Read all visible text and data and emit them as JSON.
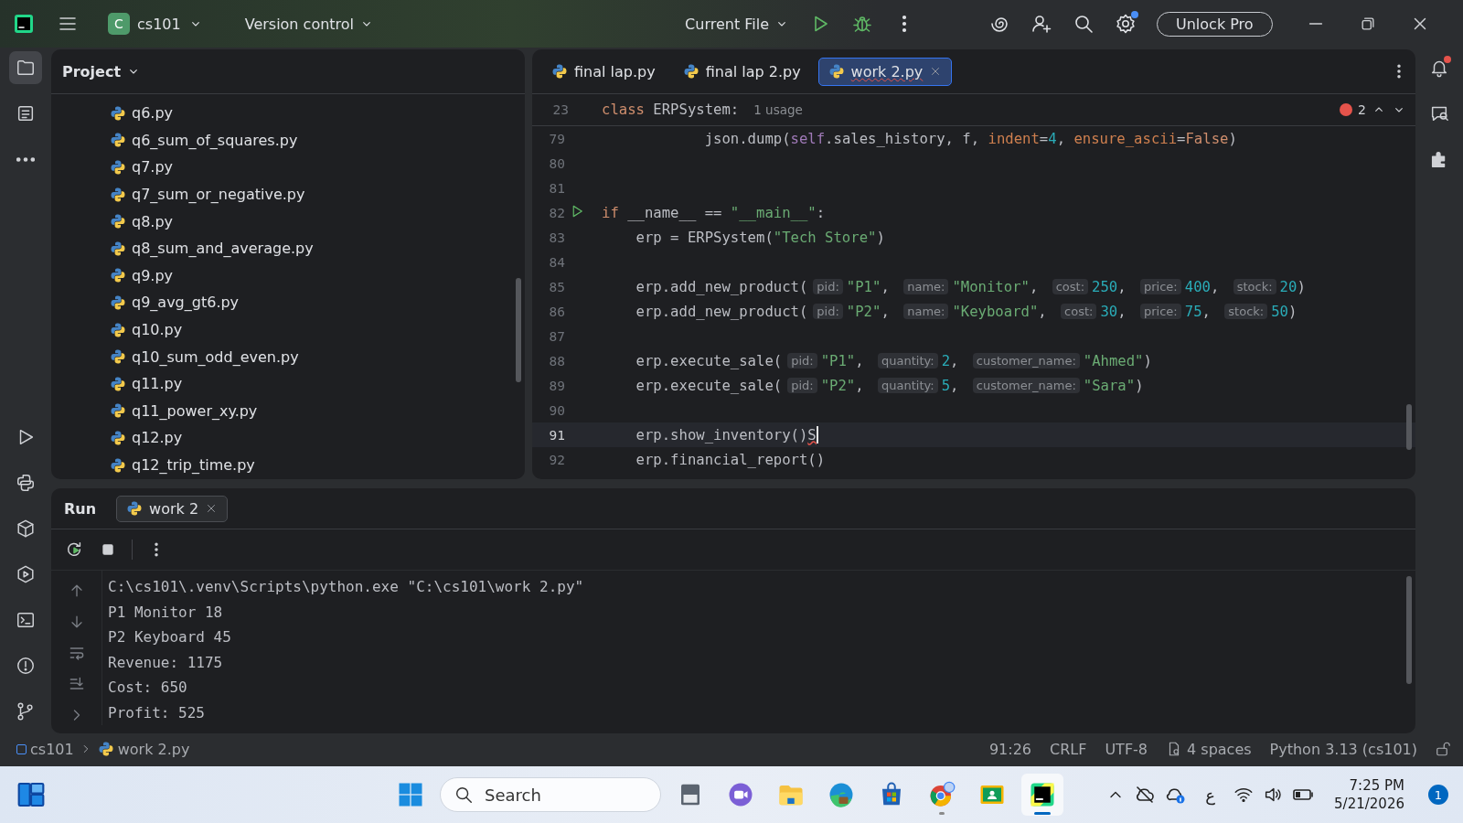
{
  "title_bar": {
    "project_badge": "C",
    "project": "cs101",
    "vcs": "Version control",
    "run_config": "Current File",
    "settings_update": true,
    "unlock_button": "Unlock Pro"
  },
  "left_tools": [
    {
      "kind": "folder",
      "selected": true
    },
    {
      "kind": "structure",
      "selected": false
    },
    {
      "kind": "more",
      "selected": false
    },
    {
      "kind": "run",
      "selected": false
    },
    {
      "kind": "console",
      "selected": false
    },
    {
      "kind": "packages",
      "selected": false
    },
    {
      "kind": "services",
      "selected": false
    },
    {
      "kind": "terminal",
      "selected": false
    },
    {
      "kind": "problems",
      "selected": false
    },
    {
      "kind": "git",
      "selected": false
    }
  ],
  "right_tools": [
    {
      "kind": "bell",
      "unread": true
    },
    {
      "kind": "chat",
      "unread": false
    },
    {
      "kind": "plugin",
      "unread": false
    }
  ],
  "project": {
    "title": "Project",
    "files": [
      "q6.py",
      "q6_sum_of_squares.py",
      "q7.py",
      "q7_sum_or_negative.py",
      "q8.py",
      "q8_sum_and_average.py",
      "q9.py",
      "q9_avg_gt6.py",
      "q10.py",
      "q10_sum_odd_even.py",
      "q11.py",
      "q11_power_xy.py",
      "q12.py",
      "q12_trip_time.py"
    ]
  },
  "editor": {
    "tabs": [
      {
        "label": "final lap.py",
        "selected": false,
        "error": false
      },
      {
        "label": "final lap 2.py",
        "selected": false,
        "error": false
      },
      {
        "label": "work 2.py",
        "selected": true,
        "error": true
      }
    ],
    "sticky": {
      "number": "23",
      "tokens": [
        {
          "kind": "kw",
          "text": "class"
        },
        {
          "kind": "plain",
          "text": " ERPSystem:"
        },
        {
          "kind": "usage",
          "text": "1 usage"
        }
      ]
    },
    "error_count": "2",
    "lines": [
      {
        "number": "79",
        "run_marker": false,
        "current": false,
        "caret": false,
        "tokens": [
          {
            "kind": "plain",
            "text": "            json.dump("
          },
          {
            "kind": "self",
            "text": "self"
          },
          {
            "kind": "plain",
            "text": ".sales_history, f, "
          },
          {
            "kind": "param",
            "text": "indent"
          },
          {
            "kind": "plain",
            "text": "="
          },
          {
            "kind": "num",
            "text": "4"
          },
          {
            "kind": "plain",
            "text": ", "
          },
          {
            "kind": "param",
            "text": "ensure_ascii"
          },
          {
            "kind": "plain",
            "text": "="
          },
          {
            "kind": "kw",
            "text": "False"
          },
          {
            "kind": "plain",
            "text": ")"
          }
        ]
      },
      {
        "number": "80",
        "run_marker": false,
        "current": false,
        "caret": false
      },
      {
        "number": "81",
        "run_marker": false,
        "current": false,
        "caret": false
      },
      {
        "number": "82",
        "run_marker": true,
        "current": false,
        "caret": false,
        "tokens": [
          {
            "kind": "kw",
            "text": "if"
          },
          {
            "kind": "plain",
            "text": " __name__ == "
          },
          {
            "kind": "str",
            "text": "\"__main__\""
          },
          {
            "kind": "plain",
            "text": ":"
          }
        ]
      },
      {
        "number": "83",
        "run_marker": false,
        "current": false,
        "caret": false,
        "tokens": [
          {
            "kind": "plain",
            "text": "    erp = ERPSystem("
          },
          {
            "kind": "str",
            "text": "\"Tech Store\""
          },
          {
            "kind": "plain",
            "text": ")"
          }
        ]
      },
      {
        "number": "84",
        "run_marker": false,
        "current": false,
        "caret": false
      },
      {
        "number": "85",
        "run_marker": false,
        "current": false,
        "caret": false,
        "tokens": [
          {
            "kind": "plain",
            "text": "    erp.add_new_product("
          },
          {
            "kind": "hint",
            "text": "pid:"
          },
          {
            "kind": "str",
            "text": "\"P1\""
          },
          {
            "kind": "plain",
            "text": ", "
          },
          {
            "kind": "hint",
            "text": "name:"
          },
          {
            "kind": "str",
            "text": "\"Monitor\""
          },
          {
            "kind": "plain",
            "text": ", "
          },
          {
            "kind": "hint",
            "text": "cost:"
          },
          {
            "kind": "num",
            "text": "250"
          },
          {
            "kind": "plain",
            "text": ", "
          },
          {
            "kind": "hint",
            "text": "price:"
          },
          {
            "kind": "num",
            "text": "400"
          },
          {
            "kind": "plain",
            "text": ", "
          },
          {
            "kind": "hint",
            "text": "stock:"
          },
          {
            "kind": "num",
            "text": "20"
          },
          {
            "kind": "plain",
            "text": ")"
          }
        ]
      },
      {
        "number": "86",
        "run_marker": false,
        "current": false,
        "caret": false,
        "tokens": [
          {
            "kind": "plain",
            "text": "    erp.add_new_product("
          },
          {
            "kind": "hint",
            "text": "pid:"
          },
          {
            "kind": "str",
            "text": "\"P2\""
          },
          {
            "kind": "plain",
            "text": ", "
          },
          {
            "kind": "hint",
            "text": "name:"
          },
          {
            "kind": "str",
            "text": "\"Keyboard\""
          },
          {
            "kind": "plain",
            "text": ", "
          },
          {
            "kind": "hint",
            "text": "cost:"
          },
          {
            "kind": "num",
            "text": "30"
          },
          {
            "kind": "plain",
            "text": ", "
          },
          {
            "kind": "hint",
            "text": "price:"
          },
          {
            "kind": "num",
            "text": "75"
          },
          {
            "kind": "plain",
            "text": ", "
          },
          {
            "kind": "hint",
            "text": "stock:"
          },
          {
            "kind": "num",
            "text": "50"
          },
          {
            "kind": "plain",
            "text": ")"
          }
        ]
      },
      {
        "number": "87",
        "run_marker": false,
        "current": false,
        "caret": false
      },
      {
        "number": "88",
        "run_marker": false,
        "current": false,
        "caret": false,
        "tokens": [
          {
            "kind": "plain",
            "text": "    erp.execute_sale("
          },
          {
            "kind": "hint",
            "text": "pid:"
          },
          {
            "kind": "str",
            "text": "\"P1\""
          },
          {
            "kind": "plain",
            "text": ", "
          },
          {
            "kind": "hint",
            "text": "quantity:"
          },
          {
            "kind": "num",
            "text": "2"
          },
          {
            "kind": "plain",
            "text": ", "
          },
          {
            "kind": "hint",
            "text": "customer_name:"
          },
          {
            "kind": "str",
            "text": "\"Ahmed\""
          },
          {
            "kind": "plain",
            "text": ")"
          }
        ]
      },
      {
        "number": "89",
        "run_marker": false,
        "current": false,
        "caret": false,
        "tokens": [
          {
            "kind": "plain",
            "text": "    erp.execute_sale("
          },
          {
            "kind": "hint",
            "text": "pid:"
          },
          {
            "kind": "str",
            "text": "\"P2\""
          },
          {
            "kind": "plain",
            "text": ", "
          },
          {
            "kind": "hint",
            "text": "quantity:"
          },
          {
            "kind": "num",
            "text": "5"
          },
          {
            "kind": "plain",
            "text": ", "
          },
          {
            "kind": "hint",
            "text": "customer_name:"
          },
          {
            "kind": "str",
            "text": "\"Sara\""
          },
          {
            "kind": "plain",
            "text": ")"
          }
        ]
      },
      {
        "number": "90",
        "run_marker": false,
        "current": false,
        "caret": false
      },
      {
        "number": "91",
        "run_marker": false,
        "current": true,
        "caret": true,
        "tokens": [
          {
            "kind": "plain",
            "text": "    erp.show_inventory()"
          },
          {
            "kind": "error",
            "text": "S"
          }
        ]
      },
      {
        "number": "92",
        "run_marker": false,
        "current": false,
        "caret": false,
        "tokens": [
          {
            "kind": "plain",
            "text": "    erp.financial_report()"
          }
        ]
      }
    ]
  },
  "run_panel": {
    "title": "Run",
    "tabs": [
      {
        "label": "work 2",
        "selected": true
      }
    ],
    "output": [
      "C:\\cs101\\.venv\\Scripts\\python.exe \"C:\\cs101\\work 2.py\"",
      "P1 Monitor 18",
      "P2 Keyboard 45",
      "Revenue: 1175",
      "Cost: 650",
      "Profit: 525"
    ]
  },
  "status_bar": {
    "breadcrumb": [
      "cs101",
      "work 2.py"
    ],
    "items": [
      {
        "kind": "text",
        "text": "91:26"
      },
      {
        "kind": "text",
        "text": "CRLF"
      },
      {
        "kind": "text",
        "text": "UTF-8"
      },
      {
        "kind": "indent",
        "text": "4 spaces"
      },
      {
        "kind": "text",
        "text": "Python 3.13 (cs101)"
      }
    ]
  },
  "taskbar": {
    "search": "Search",
    "apps": [
      {
        "kind": "scanner",
        "running": false,
        "focused": false
      },
      {
        "kind": "meet",
        "running": false,
        "focused": false
      },
      {
        "kind": "folder",
        "running": false,
        "focused": false
      },
      {
        "kind": "edge",
        "running": false,
        "focused": false
      },
      {
        "kind": "store",
        "running": false,
        "focused": false
      },
      {
        "kind": "chrome",
        "running": true,
        "focused": false
      },
      {
        "kind": "classroom",
        "running": false,
        "focused": false
      },
      {
        "kind": "pycharm",
        "running": true,
        "focused": true
      }
    ],
    "language": "ع",
    "time": "7:25 PM",
    "date": "5/21/2026",
    "notifications": "1"
  }
}
